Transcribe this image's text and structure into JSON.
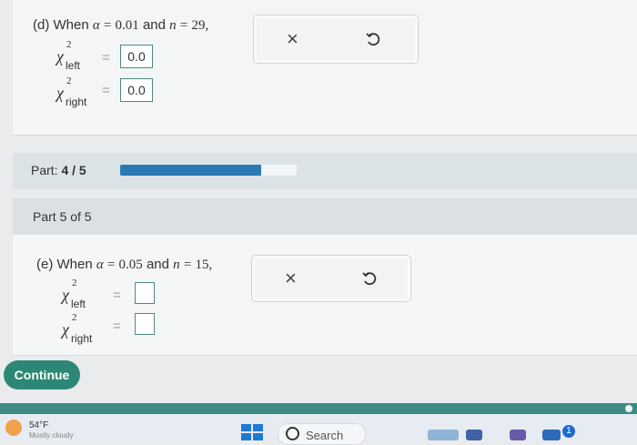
{
  "part_d": {
    "label": "(d) When",
    "alpha_sym": "α",
    "eq1": "=",
    "alpha_val": "0.01",
    "and": "and",
    "n_sym": "n",
    "eq2": "=",
    "n_val": "29,",
    "chi_symbol": "χ",
    "sup": "2",
    "left_sub": "left",
    "right_sub": "right",
    "equals": "=",
    "left_value": "0.0",
    "right_value": "0.0"
  },
  "part_e": {
    "label": "(e) When",
    "alpha_sym": "α",
    "eq1": "=",
    "alpha_val": "0.05",
    "and": "and",
    "n_sym": "n",
    "eq2": "=",
    "n_val": "15,",
    "chi_symbol": "χ",
    "sup": "2",
    "left_sub": "left",
    "right_sub": "right",
    "equals": "=",
    "left_value": "",
    "right_value": ""
  },
  "tools": {
    "clear_icon": "×"
  },
  "progress": {
    "label": "Part:",
    "value": "4 / 5",
    "fraction": 0.8
  },
  "section": {
    "title": "Part 5 of 5"
  },
  "continue_label": "Continue",
  "taskbar": {
    "temp": "54°F",
    "weather_sub": "Mostly cloudy",
    "search": "Search",
    "notification_count": "1"
  },
  "colors": {
    "accent": "#2c8776",
    "progress_fill": "#2a79b3",
    "input_border": "#4d8a7c"
  }
}
